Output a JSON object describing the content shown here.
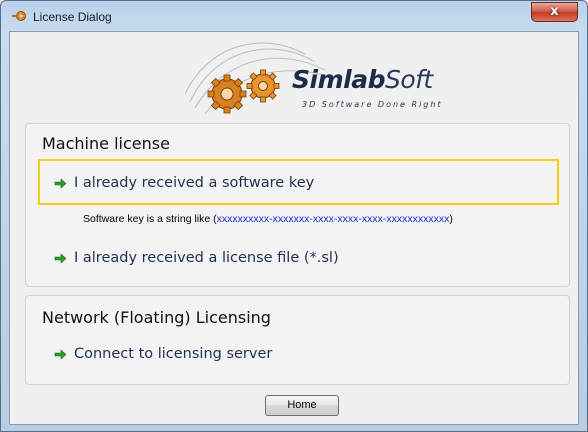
{
  "window": {
    "title": "License Dialog",
    "close_label": "x"
  },
  "logo": {
    "brand": "SimlabSoft",
    "brand_bold": "Simlab",
    "brand_light": "Soft",
    "tagline": "3D Software Done Right"
  },
  "machine": {
    "title": "Machine license",
    "software_key_option": "I already received a software key",
    "hint_prefix": "Software key is a  string like (",
    "hint_pattern": "xxxxxxxxxx-xxxxxxx-xxxx-xxxx-xxxx-xxxxxxxxxxxx",
    "hint_suffix": ")",
    "license_file_option": "I already received a license file (*.sl)"
  },
  "network": {
    "title": "Network (Floating) Licensing",
    "server_option": "Connect to licensing server"
  },
  "footer": {
    "home_label": "Home"
  },
  "colors": {
    "highlight": "#f4cf16",
    "arrow": "#2e9a2e",
    "pattern_text": "#1a2bd4"
  },
  "icons": [
    "app-icon",
    "close-icon",
    "gear-logo-icon",
    "green-arrow-icon"
  ]
}
